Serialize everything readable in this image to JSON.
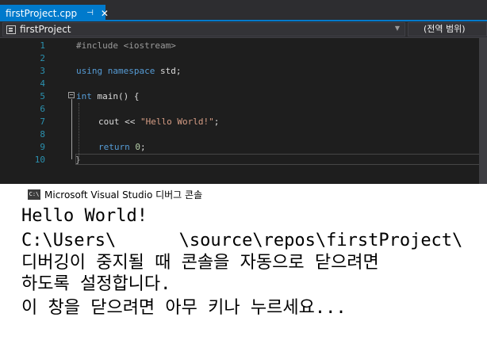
{
  "tab": {
    "title": "firstProject.cpp",
    "pin_glyph": "⊣",
    "close_glyph": "✕"
  },
  "navbar": {
    "project": "firstProject",
    "scope": "(전역 범위)"
  },
  "editor": {
    "lines": [
      {
        "n": "1",
        "parts": [
          [
            "pp",
            "#include <iostream>"
          ]
        ]
      },
      {
        "n": "2",
        "parts": []
      },
      {
        "n": "3",
        "parts": [
          [
            "kw",
            "using"
          ],
          [
            "",
            " "
          ],
          [
            "kw",
            "namespace"
          ],
          [
            "",
            " std;"
          ]
        ]
      },
      {
        "n": "4",
        "parts": []
      },
      {
        "n": "5",
        "parts": [
          [
            "kw",
            "int"
          ],
          [
            "",
            " main() {"
          ]
        ]
      },
      {
        "n": "6",
        "parts": []
      },
      {
        "n": "7",
        "parts": [
          [
            "",
            "cout << "
          ],
          [
            "str",
            "\"Hello World!\""
          ],
          [
            "",
            ";"
          ]
        ]
      },
      {
        "n": "8",
        "parts": []
      },
      {
        "n": "9",
        "parts": [
          [
            "kw",
            "return"
          ],
          [
            "",
            " "
          ],
          [
            "num",
            "0"
          ],
          [
            "",
            ";"
          ]
        ]
      },
      {
        "n": "10",
        "parts": [
          [
            "punct",
            "}"
          ]
        ]
      }
    ]
  },
  "console": {
    "title": "Microsoft Visual Studio 디버그 콘솔",
    "icon_label": "C:\\",
    "lines": [
      "Hello World!",
      "C:\\Users\\      \\source\\repos\\firstProject\\",
      "디버깅이 중지될 때 콘솔을 자동으로 닫으려면",
      "하도록 설정합니다.",
      "이 창을 닫으려면 아무 키나 누르세요..."
    ]
  }
}
